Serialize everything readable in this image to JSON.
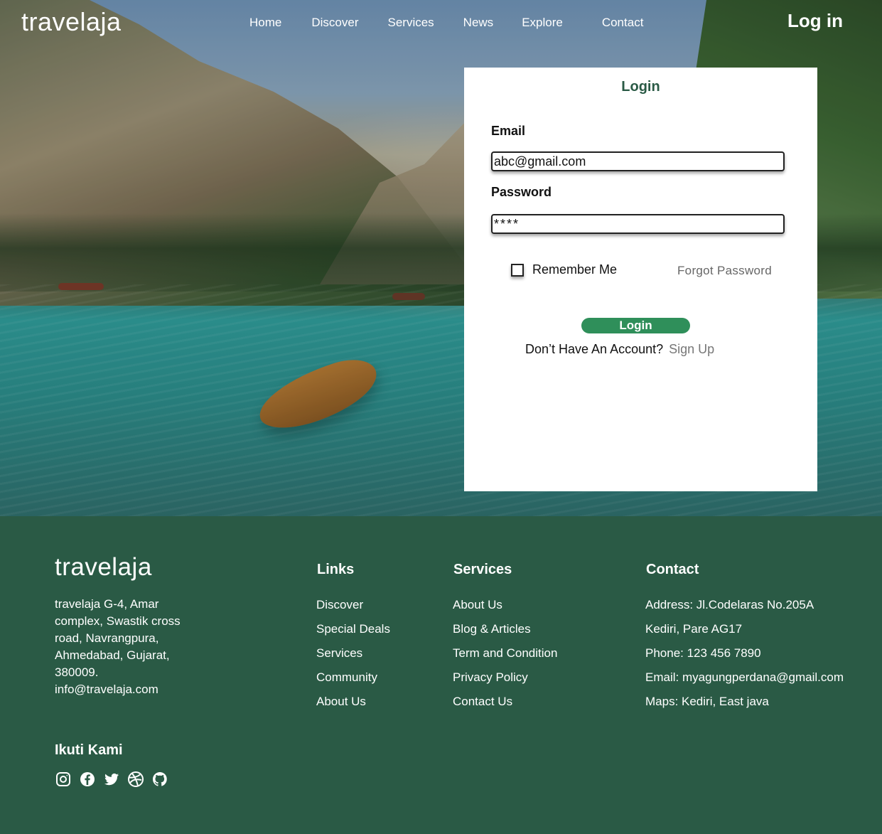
{
  "nav": {
    "brand": "travelaja",
    "items": [
      {
        "label": "Home"
      },
      {
        "label": "Discover"
      },
      {
        "label": "Services"
      },
      {
        "label": "News"
      },
      {
        "label": "Explore"
      },
      {
        "label": "Contact"
      }
    ],
    "login_label": "Log in"
  },
  "login_card": {
    "title": "Login",
    "email_label": "Email",
    "email_value": "abc@gmail.com",
    "password_label": "Password",
    "password_value": "****",
    "remember_label": "Remember Me",
    "remember_checked": false,
    "forgot_label": "Forgot Password",
    "submit_label": "Login",
    "no_account_text": "Don’t Have An Account?",
    "signup_label": "Sign Up"
  },
  "footer": {
    "brand": "travelaja",
    "address_lines": [
      "travelaja G-4, Amar",
      "complex, Swastik cross",
      "road, Navrangpura,",
      "Ahmedabad, Gujarat,",
      "380009."
    ],
    "email": "info@travelaja.com",
    "links_heading": "Links",
    "links": [
      "Discover",
      "Special Deals",
      "Services",
      "Community",
      "About Us"
    ],
    "services_heading": "Services",
    "services": [
      "About Us",
      "Blog & Articles",
      "Term and Condition",
      "Privacy Policy",
      "Contact Us"
    ],
    "contact_heading": "Contact",
    "contact": [
      "Address: Jl.Codelaras No.205A",
      "Kediri, Pare AG17",
      "Phone: 123 456 7890",
      "Email: myagungperdana@gmail.com",
      "Maps: Kediri, East java"
    ],
    "follow_heading": "Ikuti Kami",
    "social_icons": [
      "instagram-icon",
      "facebook-icon",
      "twitter-icon",
      "dribbble-icon",
      "github-icon"
    ]
  },
  "colors": {
    "brand_green": "#2a5a45",
    "button_green": "#2f8f5a"
  }
}
